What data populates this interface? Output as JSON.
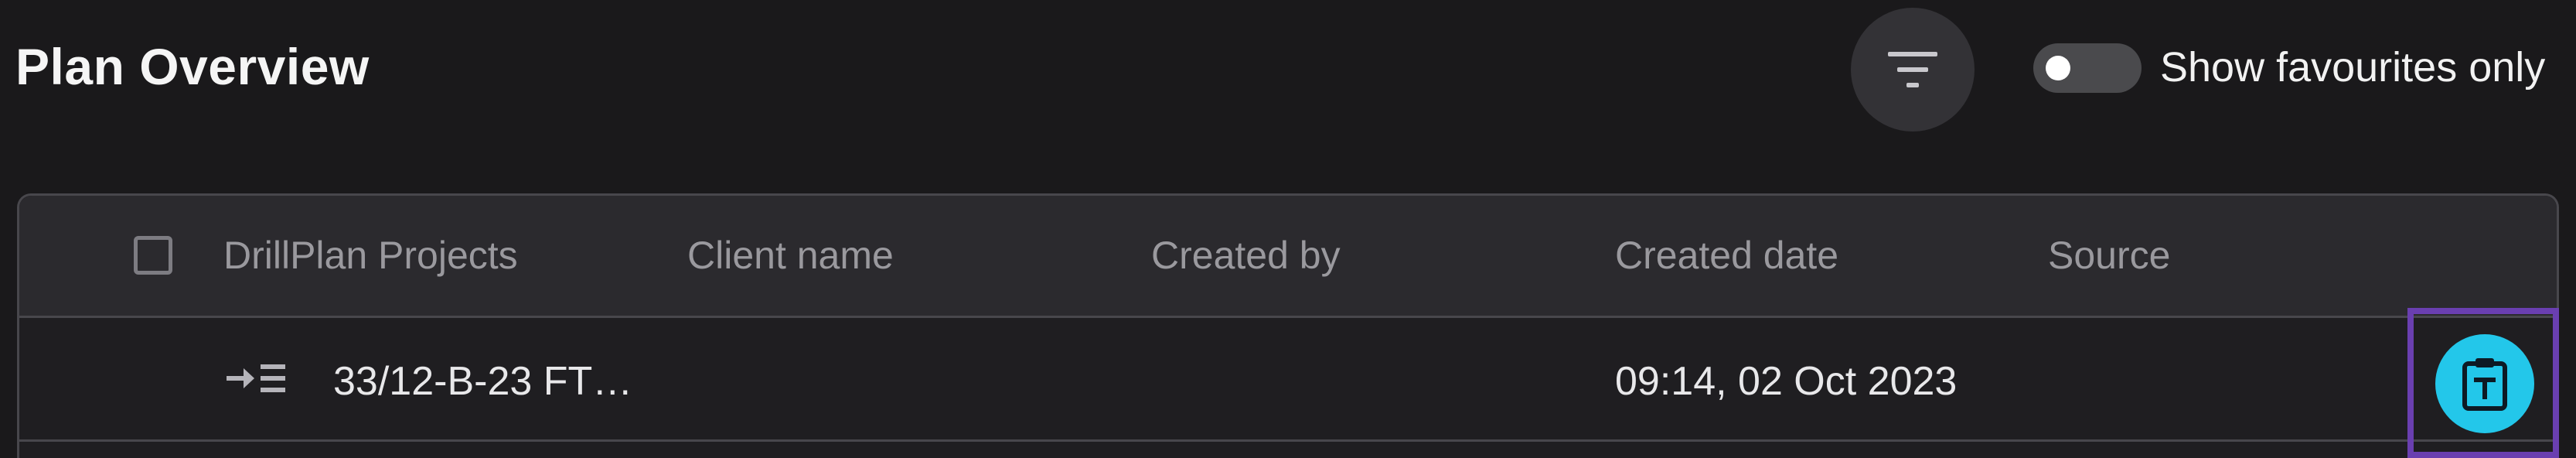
{
  "header": {
    "title": "Plan Overview",
    "filter_icon": "filter-icon",
    "favourites_toggle": {
      "label": "Show favourites only",
      "checked": false
    }
  },
  "table": {
    "columns": [
      "DrillPlan Projects",
      "Client name",
      "Created by",
      "Created date",
      "Source"
    ],
    "rows": [
      {
        "project": "33/12-B-23 FT…",
        "client_name": "",
        "created_by": "",
        "created_date": "09:14, 02 Oct 2023",
        "source": "",
        "expand_icon": "expand-tree-icon",
        "action_icon": "clipboard-t-icon"
      }
    ]
  },
  "colors": {
    "background": "#1a191b",
    "header_row": "#2b2a2e",
    "accent": "#23c7ea",
    "highlight": "#6a3fb0"
  }
}
